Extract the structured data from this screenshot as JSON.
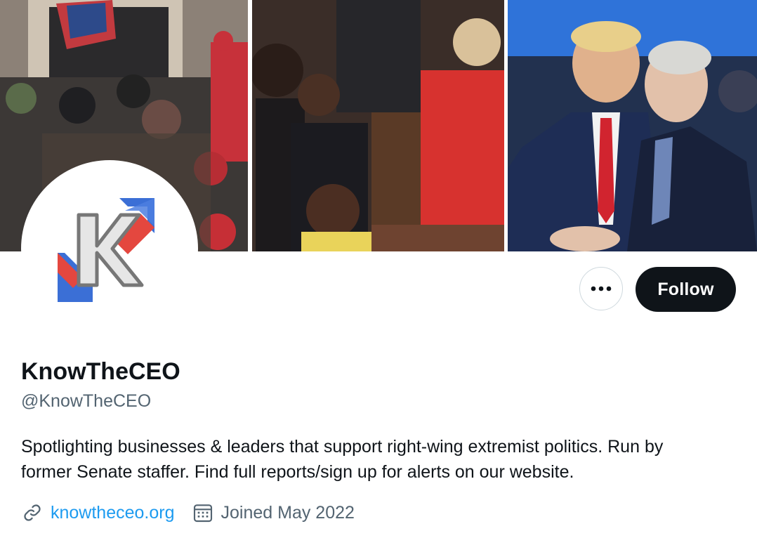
{
  "profile": {
    "name": "KnowTheCEO",
    "handle": "@KnowTheCEO",
    "bio_line1": "Spotlighting businesses & leaders that support right-wing extremist politics. Run by",
    "bio_line2": "former Senate staffer. Find full reports/sign up for alerts on our website.",
    "website": "knowtheceo.org",
    "joined": "Joined May 2022"
  },
  "actions": {
    "follow_label": "Follow",
    "more_label": "•••"
  },
  "icons": {
    "more": "more-horizontal-icon",
    "link": "link-icon",
    "calendar": "calendar-icon"
  },
  "colors": {
    "follow_bg": "#0f1419",
    "link": "#1d9bf0",
    "secondary_text": "#536471",
    "logo_red": "#e4473f",
    "logo_blue": "#3b6fd6"
  }
}
